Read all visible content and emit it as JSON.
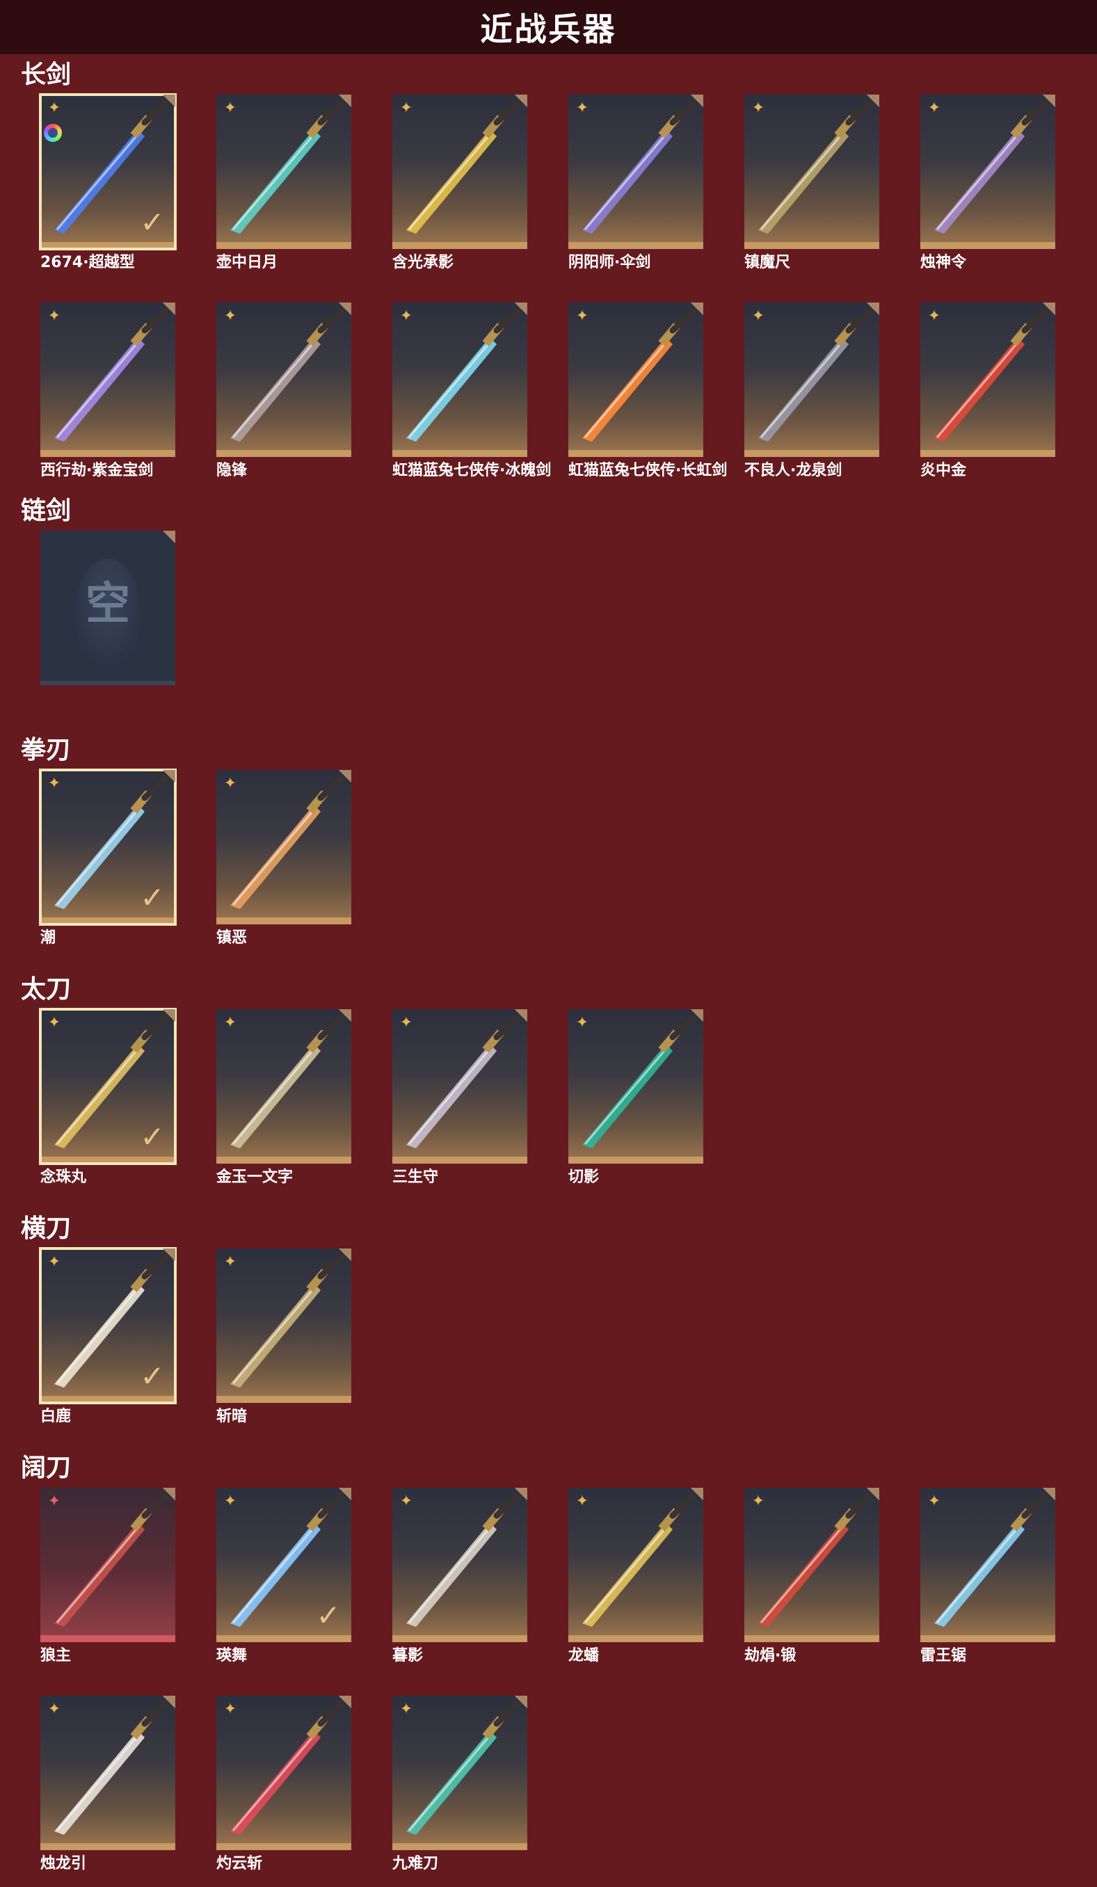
{
  "header": {
    "title": "近战兵器"
  },
  "sections": [
    {
      "title": "长剑",
      "items": [
        {
          "label": "2674·超越型",
          "selected": true,
          "equipped": true,
          "ring": true,
          "color": "#4f7df0"
        },
        {
          "label": "壶中日月",
          "color": "#5fd0c6"
        },
        {
          "label": "含光承影",
          "color": "#e5c24a"
        },
        {
          "label": "阴阳师·伞剑",
          "color": "#8a7fd8"
        },
        {
          "label": "镇魔尺",
          "color": "#b9a56a"
        },
        {
          "label": "烛神令",
          "color": "#a58ac9"
        },
        {
          "label": "西行劫·紫金宝剑",
          "color": "#a48ae8"
        },
        {
          "label": "隐锋",
          "color": "#b0a0a0"
        },
        {
          "label": "虹猫蓝兔七侠传·冰魄剑",
          "color": "#7fd8f0"
        },
        {
          "label": "虹猫蓝兔七侠传·长虹剑",
          "color": "#ff8a3a"
        },
        {
          "label": "不良人·龙泉剑",
          "color": "#9a9aa8"
        },
        {
          "label": "炎中金",
          "color": "#e2493a"
        }
      ]
    },
    {
      "title": "链剑",
      "items": [
        {
          "label": "",
          "empty": true,
          "empty_glyph": "空"
        }
      ]
    },
    {
      "title": "拳刃",
      "items": [
        {
          "label": "潮",
          "selected": true,
          "equipped": true,
          "color": "#9fd4f2"
        },
        {
          "label": "镇恶",
          "color": "#e9a060"
        }
      ]
    },
    {
      "title": "太刀",
      "items": [
        {
          "label": "念珠丸",
          "selected": true,
          "equipped": true,
          "color": "#e2c060"
        },
        {
          "label": "金玉一文字",
          "color": "#cfc29a"
        },
        {
          "label": "三生守",
          "color": "#c8c0d0"
        },
        {
          "label": "切影",
          "color": "#2fb59a"
        }
      ]
    },
    {
      "title": "横刀",
      "items": [
        {
          "label": "白鹿",
          "selected": true,
          "equipped": true,
          "color": "#ece6d2"
        },
        {
          "label": "斩暗",
          "color": "#c9b27a"
        }
      ]
    },
    {
      "title": "阔刀",
      "items": [
        {
          "label": "狼主",
          "red": true,
          "color": "#c8524a"
        },
        {
          "label": "瑛舞",
          "equipped": true,
          "color": "#8ac8ff"
        },
        {
          "label": "暮影",
          "color": "#d8d2c4"
        },
        {
          "label": "龙蟠",
          "color": "#e2c25a"
        },
        {
          "label": "劫焆·锻",
          "color": "#d84a3a"
        },
        {
          "label": "雷王锯",
          "color": "#8ad0f0"
        },
        {
          "label": "烛龙引",
          "color": "#e8e2da"
        },
        {
          "label": "灼云斩",
          "color": "#e24a5a"
        },
        {
          "label": "九难刀",
          "color": "#4fc8b0"
        }
      ]
    }
  ],
  "icons": {
    "star": "star-icon",
    "check": "checkmark-icon",
    "ring": "color-ring-icon",
    "corner": "corner-fold-icon"
  }
}
